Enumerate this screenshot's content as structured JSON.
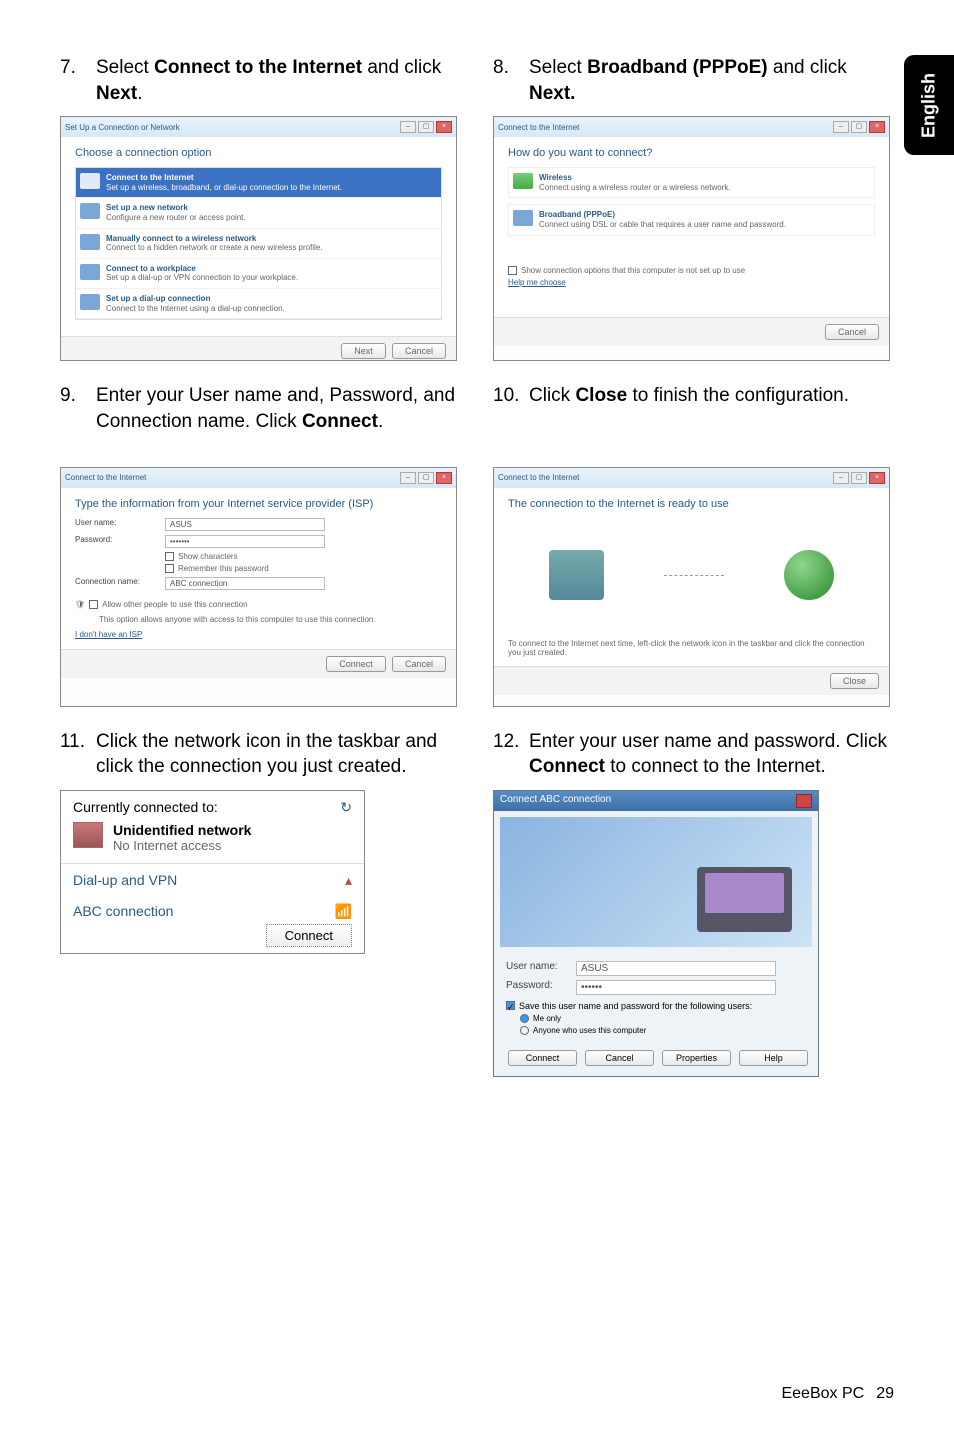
{
  "sideTab": "English",
  "steps": {
    "s7": {
      "num": "7.",
      "text_a": "Select ",
      "bold_a": "Connect to the Internet",
      "text_b": " and click ",
      "bold_b": "Next",
      "text_c": "."
    },
    "s8": {
      "num": "8.",
      "text_a": "Select ",
      "bold_a": "Broadband (PPPoE)",
      "text_b": " and click ",
      "bold_b": "Next.",
      "text_c": ""
    },
    "s9": {
      "num": "9.",
      "text_a": "Enter your User name and, Password, and Connection name. Click ",
      "bold_a": "Connect",
      "text_b": "."
    },
    "s10": {
      "num": "10.",
      "text_a": "Click ",
      "bold_a": "Close",
      "text_b": " to finish the configuration."
    },
    "s11": {
      "num": "11.",
      "text_a": "Click the network icon in the taskbar and click the connection you just created."
    },
    "s12": {
      "num": "12.",
      "text_a": "Enter your user name and password. Click ",
      "bold_a": "Connect",
      "text_b": " to connect to the Internet."
    }
  },
  "win7": {
    "title": "Set Up a Connection or Network",
    "heading": "Choose a connection option",
    "options": [
      {
        "t": "Connect to the Internet",
        "d": "Set up a wireless, broadband, or dial-up connection to the Internet."
      },
      {
        "t": "Set up a new network",
        "d": "Configure a new router or access point."
      },
      {
        "t": "Manually connect to a wireless network",
        "d": "Connect to a hidden network or create a new wireless profile."
      },
      {
        "t": "Connect to a workplace",
        "d": "Set up a dial-up or VPN connection to your workplace."
      },
      {
        "t": "Set up a dial-up connection",
        "d": "Connect to the Internet using a dial-up connection."
      }
    ],
    "btnNext": "Next",
    "btnCancel": "Cancel"
  },
  "win8": {
    "title": "Connect to the Internet",
    "heading": "How do you want to connect?",
    "opt1t": "Wireless",
    "opt1d": "Connect using a wireless router or a wireless network.",
    "opt2t": "Broadband (PPPoE)",
    "opt2d": "Connect using DSL or cable that requires a user name and password.",
    "help": "Help me choose",
    "showLine": "Show connection options that this computer is not set up to use",
    "btnCancel": "Cancel"
  },
  "win9": {
    "title": "Connect to the Internet",
    "heading": "Type the information from your Internet service provider (ISP)",
    "labUser": "User name:",
    "valUser": "ASUS",
    "labPass": "Password:",
    "valPass": "•••••••",
    "cbShow": "Show characters",
    "cbRemember": "Remember this password",
    "labConn": "Connection name:",
    "valConn": "ABC connection",
    "cbAllow": "Allow other people to use this connection",
    "allowSub": "This option allows anyone with access to this computer to use this connection.",
    "link": "I don't have an ISP",
    "btnConnect": "Connect",
    "btnCancel": "Cancel"
  },
  "win10": {
    "title": "Connect to the Internet",
    "heading": "The connection to the Internet is ready to use",
    "info": "To connect to the Internet next time, left-click the network icon in the taskbar and click the connection you just created.",
    "btnClose": "Close"
  },
  "flyout": {
    "header": "Currently connected to:",
    "netName": "Unidentified network",
    "netSub": "No Internet access",
    "section": "Dial-up and VPN",
    "conn": "ABC connection",
    "btn": "Connect"
  },
  "dial": {
    "title": "Connect ABC connection",
    "labUser": "User name:",
    "valUser": "ASUS",
    "labPass": "Password:",
    "valPass": "••••••",
    "cbSave": "Save this user name and password for the following users:",
    "rMe": "Me only",
    "rAny": "Anyone who uses this computer",
    "btnConnect": "Connect",
    "btnCancel": "Cancel",
    "btnProp": "Properties",
    "btnHelp": "Help"
  },
  "footer": {
    "name": "EeeBox PC",
    "page": "29"
  }
}
